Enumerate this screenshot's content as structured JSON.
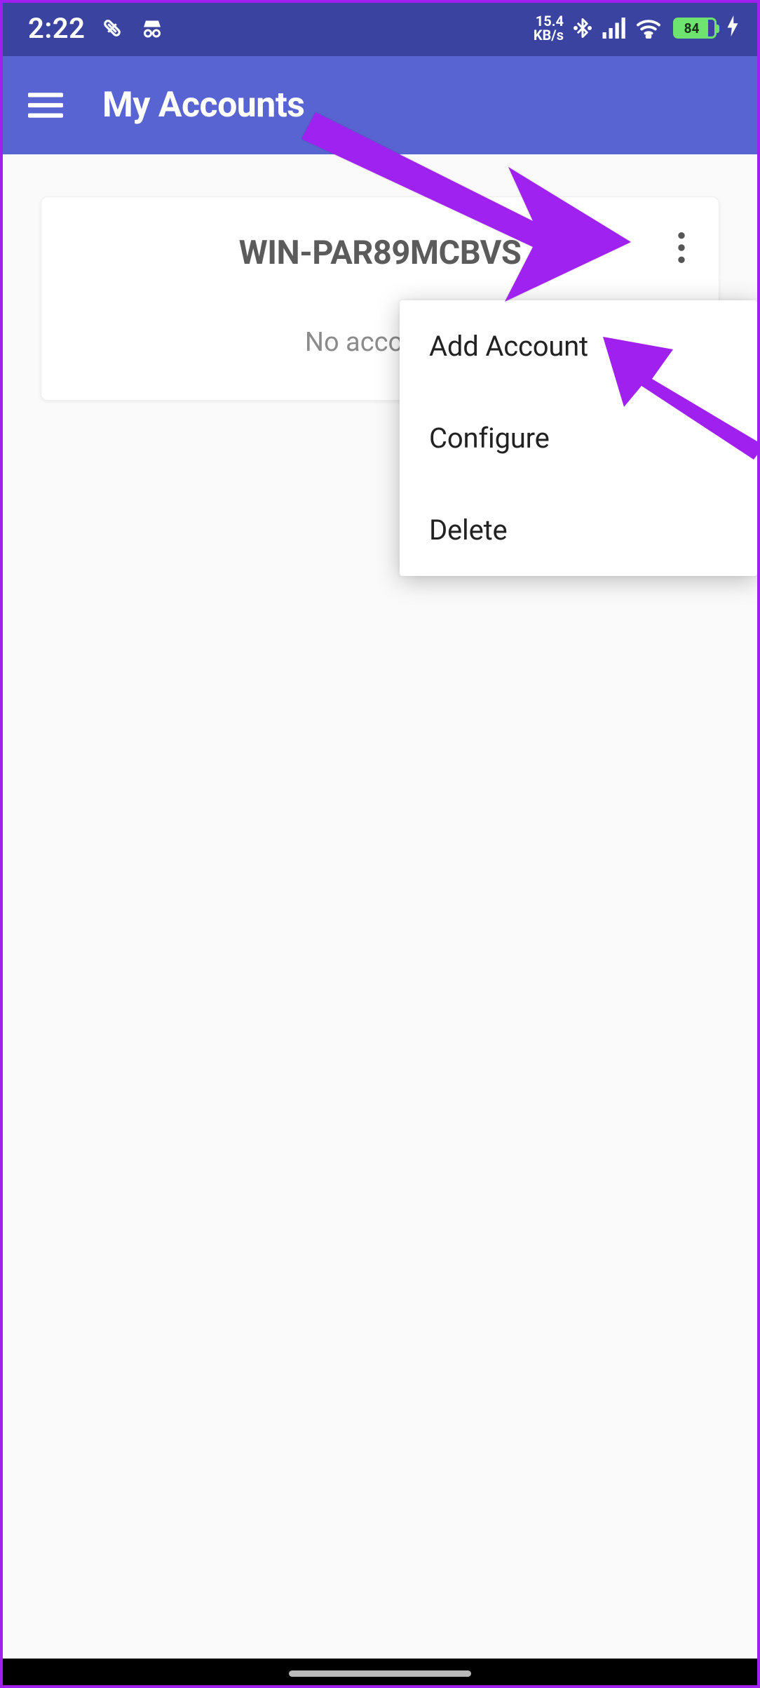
{
  "status": {
    "time": "2:22",
    "net_rate_top": "15.4",
    "net_rate_bot": "KB/s",
    "battery_pct": "84"
  },
  "appbar": {
    "title": "My Accounts"
  },
  "card": {
    "title": "WIN-PAR89MCBVS",
    "subtitle": "No accounts"
  },
  "menu": {
    "items": [
      {
        "label": "Add Account"
      },
      {
        "label": "Configure"
      },
      {
        "label": "Delete"
      }
    ]
  },
  "colors": {
    "status_bg": "#3a44a0",
    "appbar_bg": "#5764d1",
    "accent_arrow": "#a020f0"
  }
}
